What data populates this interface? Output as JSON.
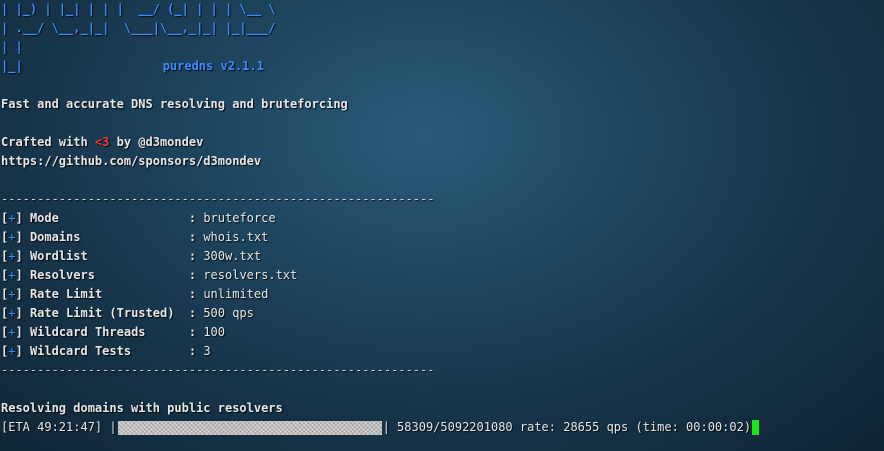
{
  "banner": {
    "line1": "| |_) | |_| | | |  __/ (_| | | | \\__ \\",
    "line2": "| .__/ \\__,_|_|  \\___|\\__,_|_| |_|___/",
    "line3": "| |",
    "line4_left": "|_|",
    "tool_name": "puredns",
    "version": "v2.1.1"
  },
  "tagline": "Fast and accurate DNS resolving and bruteforcing",
  "credits": {
    "prefix": "Crafted with ",
    "heart": "<3",
    "suffix": " by @d3mondev",
    "url": "https://github.com/sponsors/d3mondev"
  },
  "separator": "------------------------------------------------------------",
  "config": [
    {
      "bracket_open": "[",
      "plus": "+",
      "bracket_close": "]",
      "label": "Mode",
      "colon": " : ",
      "value": "bruteforce"
    },
    {
      "bracket_open": "[",
      "plus": "+",
      "bracket_close": "]",
      "label": "Domains",
      "colon": " : ",
      "value": "whois.txt"
    },
    {
      "bracket_open": "[",
      "plus": "+",
      "bracket_close": "]",
      "label": "Wordlist",
      "colon": " : ",
      "value": "300w.txt"
    },
    {
      "bracket_open": "[",
      "plus": "+",
      "bracket_close": "]",
      "label": "Resolvers",
      "colon": " : ",
      "value": "resolvers.txt"
    },
    {
      "bracket_open": "[",
      "plus": "+",
      "bracket_close": "]",
      "label": "Rate Limit",
      "colon": " : ",
      "value": "unlimited"
    },
    {
      "bracket_open": "[",
      "plus": "+",
      "bracket_close": "]",
      "label": "Rate Limit (Trusted)",
      "colon": " : ",
      "value": "500 qps"
    },
    {
      "bracket_open": "[",
      "plus": "+",
      "bracket_close": "]",
      "label": "Wildcard Threads",
      "colon": " : ",
      "value": "100"
    },
    {
      "bracket_open": "[",
      "plus": "+",
      "bracket_close": "]",
      "label": "Wildcard Tests",
      "colon": " : ",
      "value": "3"
    }
  ],
  "status": "Resolving domains with public resolvers",
  "progress": {
    "eta": "[ETA 49:21:47] |",
    "bar_end": "|",
    "stats": " 58309/5092201080 rate: 28655 qps (time: 00:00:02)"
  },
  "colors": {
    "banner_blue": "#3c8cff",
    "heart_red": "#ff3333",
    "cursor_green": "#19e619"
  }
}
